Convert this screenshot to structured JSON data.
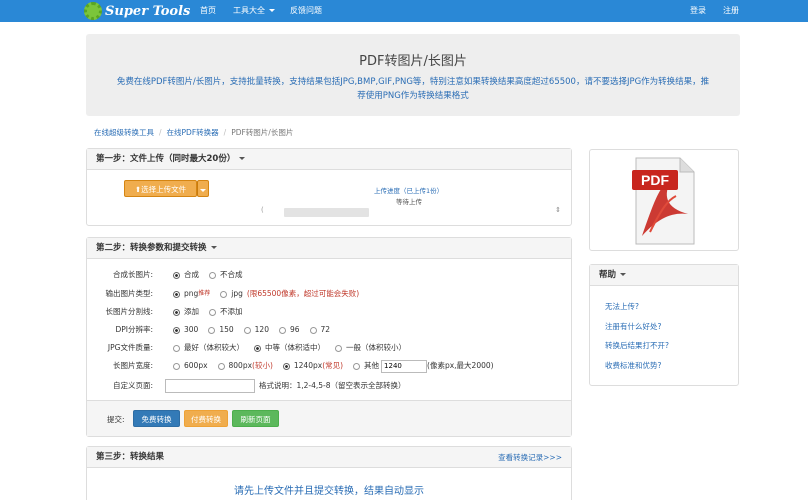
{
  "nav": {
    "logo_text": "Super Tools",
    "home": "首页",
    "tools": "工具大全",
    "feedback": "反馈问题",
    "login": "登录",
    "register": "注册"
  },
  "hero": {
    "title": "PDF转图片/长图片",
    "desc": "免费在线PDF转图片/长图片，支持批量转换，支持结果包括JPG,BMP,GIF,PNG等，特别注意如果转换结果高度超过65500，请不要选择JPG作为转换结果，推荐使用PNG作为转换结果格式"
  },
  "breadcrumb": [
    "在线超级转换工具",
    "在线PDF转换器",
    "PDF转图片/长图片"
  ],
  "step1": {
    "title": "第一步：文件上传（同时最大20份）",
    "upload_button": "选择上传文件",
    "progress_label": "上传进度（已上传1份）",
    "status": "等待上传",
    "list_placeholder": "("
  },
  "step2": {
    "title": "第二步：转换参数和提交转换",
    "merge": {
      "label": "合成长图片:",
      "options": [
        "合成",
        "不合成"
      ]
    },
    "format": {
      "label": "输出图片类型:",
      "png": "png",
      "png_badge": "推荐",
      "jpg": "jpg",
      "jpg_note": "(限65500像素，超过可能会失败)"
    },
    "divider": {
      "label": "长图片分割线:",
      "options": [
        "添加",
        "不添加"
      ]
    },
    "dpi": {
      "label": "DPI分辨率:",
      "options": [
        "300",
        "150",
        "120",
        "96",
        "72"
      ]
    },
    "quality": {
      "label": "JPG文件质量:",
      "best": "最好",
      "best_note": "（体积较大）",
      "mid": "中等",
      "mid_note": "（体积适中）",
      "normal": "一般",
      "normal_note": "（体积较小）"
    },
    "width": {
      "label": "长图片宽度:",
      "w600": "600px",
      "w800": "800px",
      "w800_note": "(较小)",
      "w1240": "1240px",
      "w1240_note": "(常见)",
      "other": "其他",
      "other_value": "1240",
      "other_note": "(像素px,最大2000)"
    },
    "pages": {
      "label": "自定义页面:",
      "value": "",
      "hint": "格式说明：1,2-4,5-8（留空表示全部转换）"
    },
    "submit_label": "提交:",
    "free_button": "免费转换",
    "paid_button": "付费转换",
    "refresh_button": "刷新页面"
  },
  "step3": {
    "title": "第三步：转换结果",
    "history_link": "查看转换记录>>>",
    "message": "请先上传文件并且提交转换，结果自动显示"
  },
  "sidebar": {
    "help_title": "帮助",
    "help_items": [
      "无法上传?",
      "注册有什么好处?",
      "转换后结果打不开?",
      "收费标准和优势?"
    ],
    "pdf_icon_text": "PDF"
  }
}
